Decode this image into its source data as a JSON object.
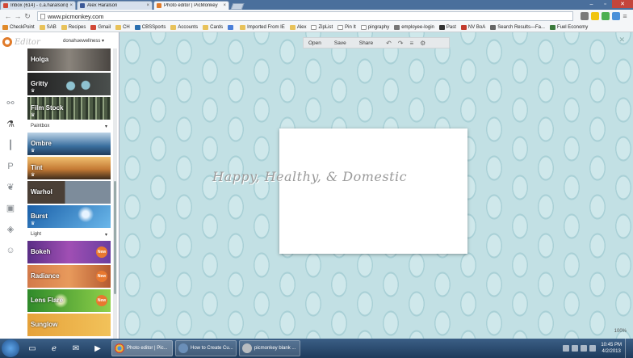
{
  "browser": {
    "tabs": [
      {
        "title": "Inbox (614) - c.a.haralson@...",
        "favicon_color": "#d14836",
        "active": false
      },
      {
        "title": "Alex Haralson",
        "favicon_color": "#3b5998",
        "active": false
      },
      {
        "title": "Photo editor | PicMonkey",
        "favicon_color": "#e07b2a",
        "active": true
      }
    ],
    "address": "www.picmonkey.com",
    "bookmarks": [
      "CheckPoint",
      "SAB",
      "Recipes",
      "Gmail",
      "CH",
      "CBSSports",
      "Accounts",
      "Cards",
      "Imported From IE",
      "Alex",
      "ZipList",
      "Pin It",
      "pingraphy",
      "employee-login",
      "Past",
      "NV BoA",
      "Search Results—Fa...",
      "Fuel Economy"
    ]
  },
  "editor": {
    "logo_text": "Editor",
    "account": "donahuewellness",
    "rail_icons": [
      "basic-edits-icon",
      "effects-icon",
      "touch-up-icon",
      "text-icon",
      "overlays-icon",
      "frames-icon",
      "textures-icon",
      "themes-icon"
    ],
    "panel": [
      {
        "kind": "tile",
        "label": "Holga",
        "bg": "#5e5a56",
        "new": false
      },
      {
        "kind": "tile",
        "label": "Gritty",
        "bg": "#3a3f3f",
        "new": false
      },
      {
        "kind": "tile",
        "label": "Film Stock",
        "bg": "#4e5b46",
        "new": false
      },
      {
        "kind": "section",
        "label": "Paintbox"
      },
      {
        "kind": "tile",
        "label": "Ombre",
        "bg": "#3e6e9c",
        "new": false
      },
      {
        "kind": "tile",
        "label": "Tint",
        "bg": "#c79454",
        "new": false
      },
      {
        "kind": "tile",
        "label": "Warhol",
        "bg": "#6d7a87",
        "new": false
      },
      {
        "kind": "tile",
        "label": "Burst",
        "bg": "#2b7fc6",
        "new": false
      },
      {
        "kind": "section",
        "label": "Light"
      },
      {
        "kind": "tile",
        "label": "Bokeh",
        "bg": "#7f4a9c",
        "new": true
      },
      {
        "kind": "tile",
        "label": "Radiance",
        "bg": "#c8683a",
        "new": true
      },
      {
        "kind": "tile",
        "label": "Lens Flare",
        "bg": "#5aa83a",
        "new": true
      },
      {
        "kind": "tile",
        "label": "Sunglow",
        "bg": "#d98a2b",
        "new": false
      }
    ],
    "new_label": "New"
  },
  "canvas": {
    "toolbar": {
      "open": "Open",
      "save": "Save",
      "share": "Share"
    },
    "watermark": "Happy, Healthy, & Domestic",
    "zoom": "100%",
    "close": "✕"
  },
  "taskbar": {
    "pinned": [
      "explorer-icon",
      "ie-icon",
      "outlook-icon",
      "media-player-icon"
    ],
    "tasks": [
      {
        "title": "Photo editor | Pic...",
        "color": "#e08a2a",
        "active": true
      },
      {
        "title": "How to Create Cu...",
        "color": "#6b8fb8",
        "active": false
      },
      {
        "title": "picmonkey blank ...",
        "color": "#9a9a9a",
        "active": false
      }
    ],
    "time": "10:45 PM",
    "date": "4/2/2013"
  }
}
